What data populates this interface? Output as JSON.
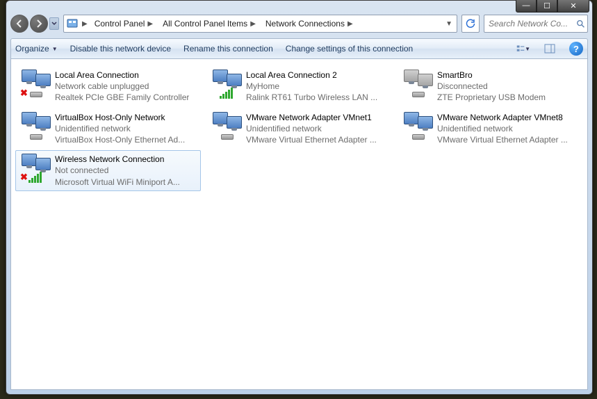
{
  "window_controls": {
    "min": "—",
    "max": "☐",
    "close": "✕"
  },
  "breadcrumbs": [
    "Control Panel",
    "All Control Panel Items",
    "Network Connections"
  ],
  "search": {
    "placeholder": "Search Network Co..."
  },
  "toolbar": {
    "organize": "Organize",
    "disable": "Disable this network device",
    "rename": "Rename this connection",
    "change": "Change settings of this connection"
  },
  "connections": [
    {
      "title": "Local Area Connection",
      "status": "Network cable unplugged",
      "device": "Realtek PCIe GBE Family Controller",
      "icon": "wired",
      "error": true
    },
    {
      "title": "Local Area Connection 2",
      "status": "MyHome",
      "device": "Ralink RT61 Turbo Wireless LAN ...",
      "icon": "wifi",
      "error": false
    },
    {
      "title": "SmartBro",
      "status": "Disconnected",
      "device": "ZTE Proprietary USB Modem",
      "icon": "off",
      "error": false
    },
    {
      "title": "VirtualBox Host-Only Network",
      "status": "Unidentified network",
      "device": "VirtualBox Host-Only Ethernet Ad...",
      "icon": "wired",
      "error": false
    },
    {
      "title": "VMware Network Adapter VMnet1",
      "status": "Unidentified network",
      "device": "VMware Virtual Ethernet Adapter ...",
      "icon": "wired",
      "error": false
    },
    {
      "title": "VMware Network Adapter VMnet8",
      "status": "Unidentified network",
      "device": "VMware Virtual Ethernet Adapter ...",
      "icon": "wired",
      "error": false
    },
    {
      "title": "Wireless Network Connection",
      "status": "Not connected",
      "device": "Microsoft Virtual WiFi Miniport A...",
      "icon": "wifi",
      "error": true,
      "selected": true
    }
  ]
}
